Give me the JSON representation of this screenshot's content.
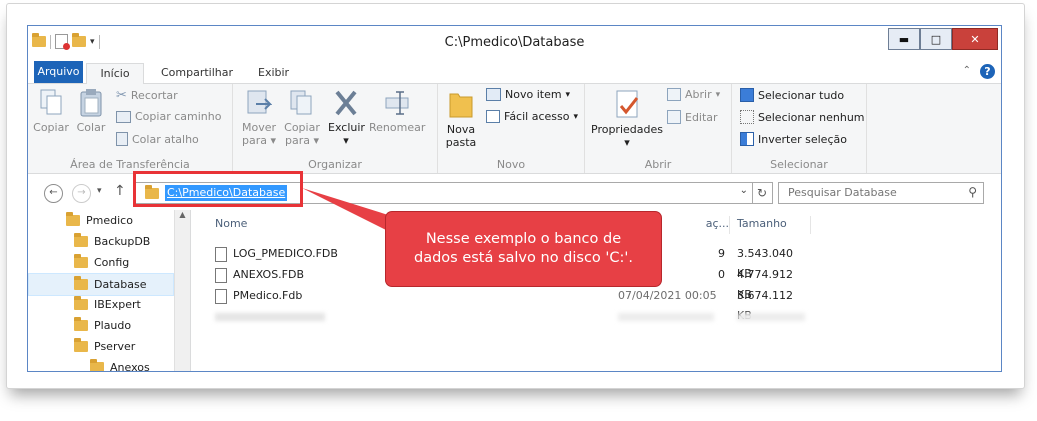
{
  "window": {
    "title": "C:\\Pmedico\\Database"
  },
  "tabs": {
    "file": "Arquivo",
    "home": "Início",
    "share": "Compartilhar",
    "view": "Exibir"
  },
  "ribbon": {
    "clipboard": {
      "label": "Área de Transferência",
      "copy": "Copiar",
      "paste": "Colar",
      "cut": "Recortar",
      "copy_path": "Copiar caminho",
      "paste_shortcut": "Colar atalho"
    },
    "organize": {
      "label": "Organizar",
      "move_to_1": "Mover",
      "move_to_2": "para",
      "copy_to_1": "Copiar",
      "copy_to_2": "para",
      "delete": "Excluir",
      "rename": "Renomear"
    },
    "new": {
      "label": "Novo",
      "new_folder_1": "Nova",
      "new_folder_2": "pasta",
      "new_item": "Novo item",
      "easy_access": "Fácil acesso"
    },
    "open": {
      "label": "Abrir",
      "properties": "Propriedades",
      "open": "Abrir",
      "edit": "Editar"
    },
    "select": {
      "label": "Selecionar",
      "select_all": "Selecionar tudo",
      "select_none": "Selecionar nenhum",
      "invert": "Inverter seleção"
    }
  },
  "address": {
    "path": "C:\\Pmedico\\Database",
    "search_placeholder": "Pesquisar Database"
  },
  "nav": {
    "items": [
      {
        "label": "Pmedico"
      },
      {
        "label": "BackupDB"
      },
      {
        "label": "Config"
      },
      {
        "label": "Database"
      },
      {
        "label": "IBExpert"
      },
      {
        "label": "Plaudo"
      },
      {
        "label": "Pserver"
      },
      {
        "label": "Anexos"
      }
    ]
  },
  "list": {
    "columns": {
      "name": "Nome",
      "date": "aç...",
      "size": "Tamanho"
    },
    "rows": [
      {
        "name": "LOG_PMEDICO.FDB",
        "date": "9",
        "size": "3.543.040 KB"
      },
      {
        "name": "ANEXOS.FDB",
        "date": "0",
        "size": "4.774.912 KB"
      },
      {
        "name": "PMedico.Fdb",
        "date": "07/04/2021 00:05",
        "size": "3.674.112 KB"
      }
    ]
  },
  "callout": {
    "line1": "Nesse exemplo o banco de",
    "line2": "dados está salvo no disco 'C:'."
  },
  "colors": {
    "accent": "#1d64b8",
    "callout": "#e74045",
    "selection": "#3399ff"
  }
}
